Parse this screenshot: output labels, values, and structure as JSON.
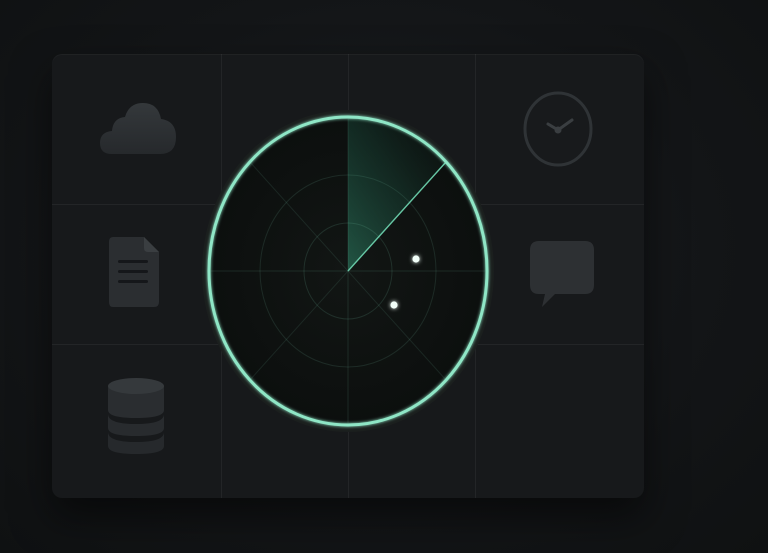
{
  "scene": {
    "theme": "dark",
    "background_color": "#131517",
    "panel_color": "#17191b",
    "accent_color": "#7fe0bf",
    "icon_color": "#2c2f32"
  },
  "tiles": {
    "left": [
      "cloud-icon",
      "document-icon",
      "database-icon"
    ],
    "right": [
      "clock-icon",
      "chat-bubble-icon"
    ]
  },
  "radar": {
    "rings": 3,
    "spokes": 4,
    "sweep": true,
    "blips": 2
  }
}
